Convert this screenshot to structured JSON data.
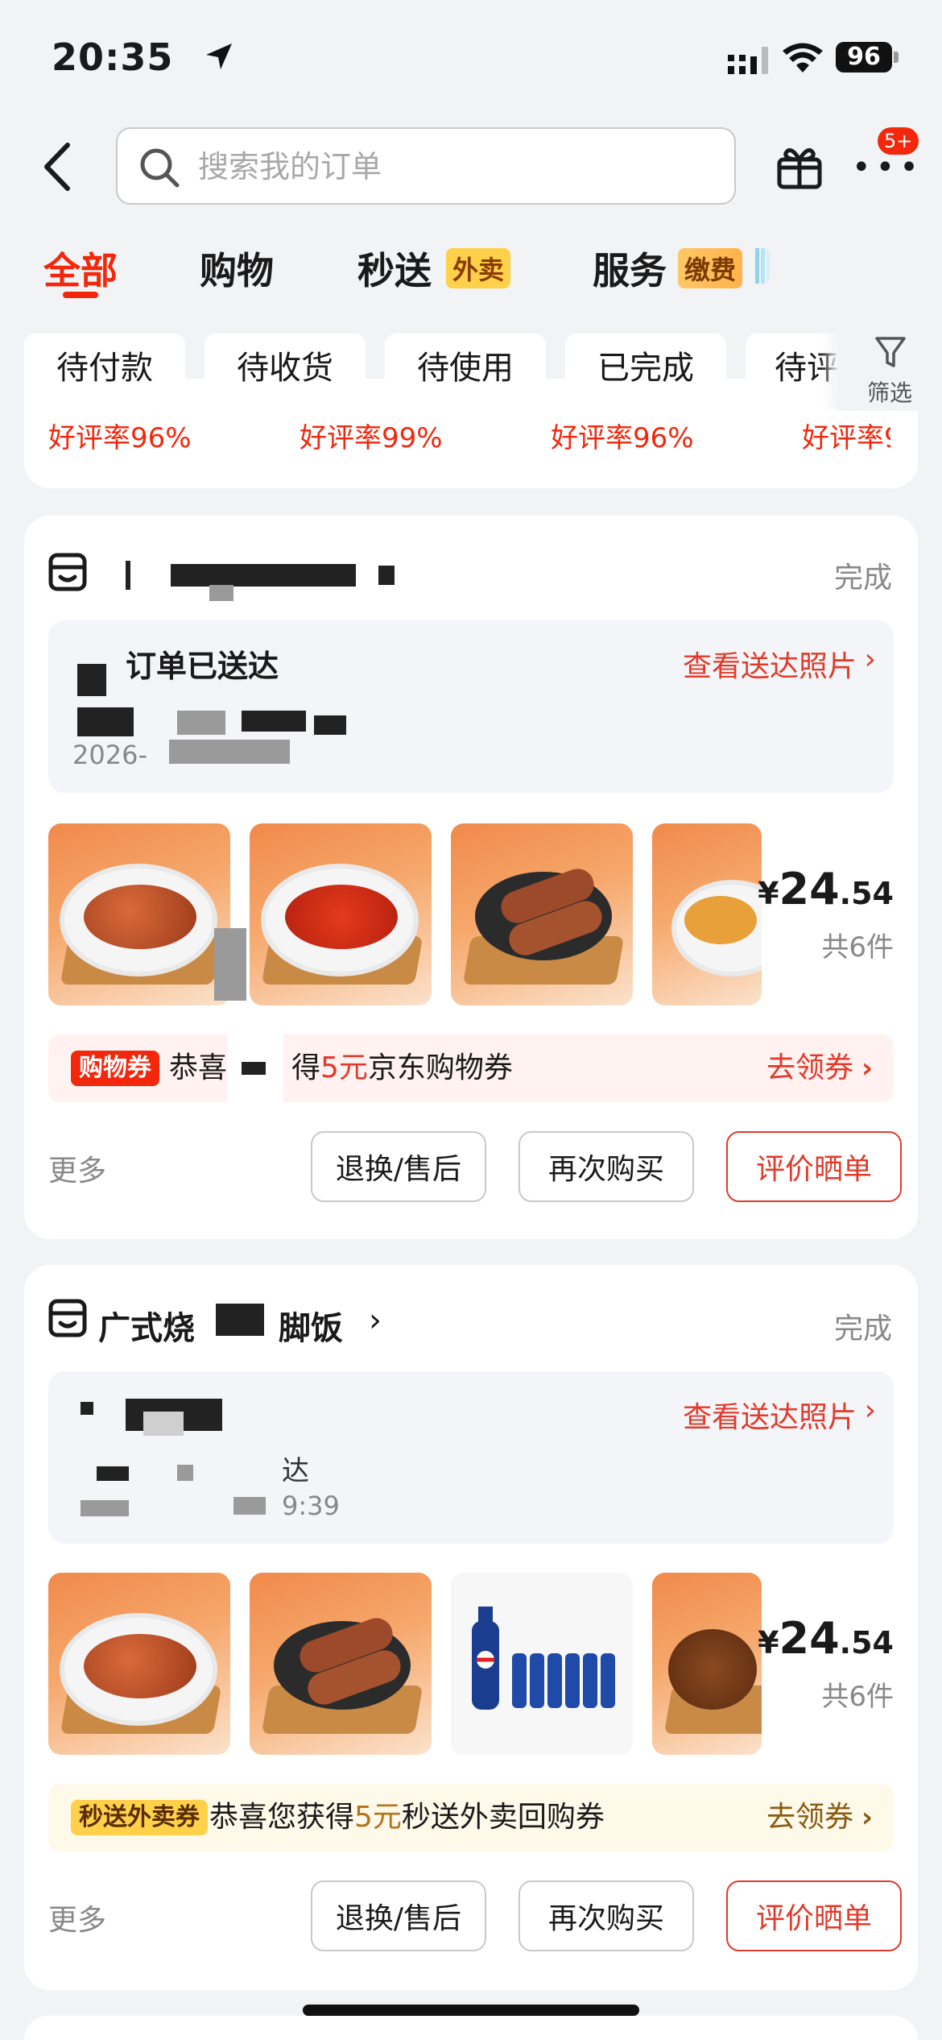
{
  "status_bar": {
    "time": "20:35",
    "battery": "96"
  },
  "header": {
    "search_placeholder": "搜索我的订单",
    "badge": "5+"
  },
  "tabs": [
    {
      "label": "全部",
      "active": true
    },
    {
      "label": "购物",
      "active": false
    },
    {
      "label": "秒送",
      "tag": "外卖",
      "active": false
    },
    {
      "label": "服务",
      "tag": "缴费",
      "active": false
    }
  ],
  "filters": {
    "chips": [
      "待付款",
      "待收货",
      "待使用",
      "已完成",
      "待评"
    ],
    "filter_label": "筛选"
  },
  "previous_card": {
    "ratings": [
      "好评率96%",
      "好评率99%",
      "好评率96%",
      "好评率9"
    ]
  },
  "orders": [
    {
      "shop_name": "",
      "status": "完成",
      "delivery_title": "订单已送达",
      "delivery_link": "查看送达照片",
      "delivery_line2": "",
      "delivery_time": "2026-",
      "price_int": "24",
      "price_dec": ".54",
      "currency": "¥",
      "count": "共6件",
      "coupon": {
        "tag": "购物券",
        "prefix": "恭喜",
        "mid": "得",
        "amount": "5元",
        "suffix": "京东购物券",
        "go": "去领券"
      },
      "more": "更多",
      "buttons": [
        "退换/售后",
        "再次购买",
        "评价晒单"
      ]
    },
    {
      "shop_name": "广式烧",
      "shop_name_tail": "脚饭",
      "status": "完成",
      "delivery_title": "",
      "delivery_link": "查看送达照片",
      "delivery_line2": "达",
      "delivery_time": "9:39",
      "price_int": "24",
      "price_dec": ".54",
      "currency": "¥",
      "count": "共6件",
      "coupon": {
        "tag": "秒送外卖券",
        "prefix": "恭喜您获得",
        "amount": "5元",
        "suffix": "秒送外卖回购券",
        "go": "去领券"
      },
      "more": "更多",
      "buttons": [
        "退换/售后",
        "再次购买",
        "评价晒单"
      ]
    }
  ]
}
